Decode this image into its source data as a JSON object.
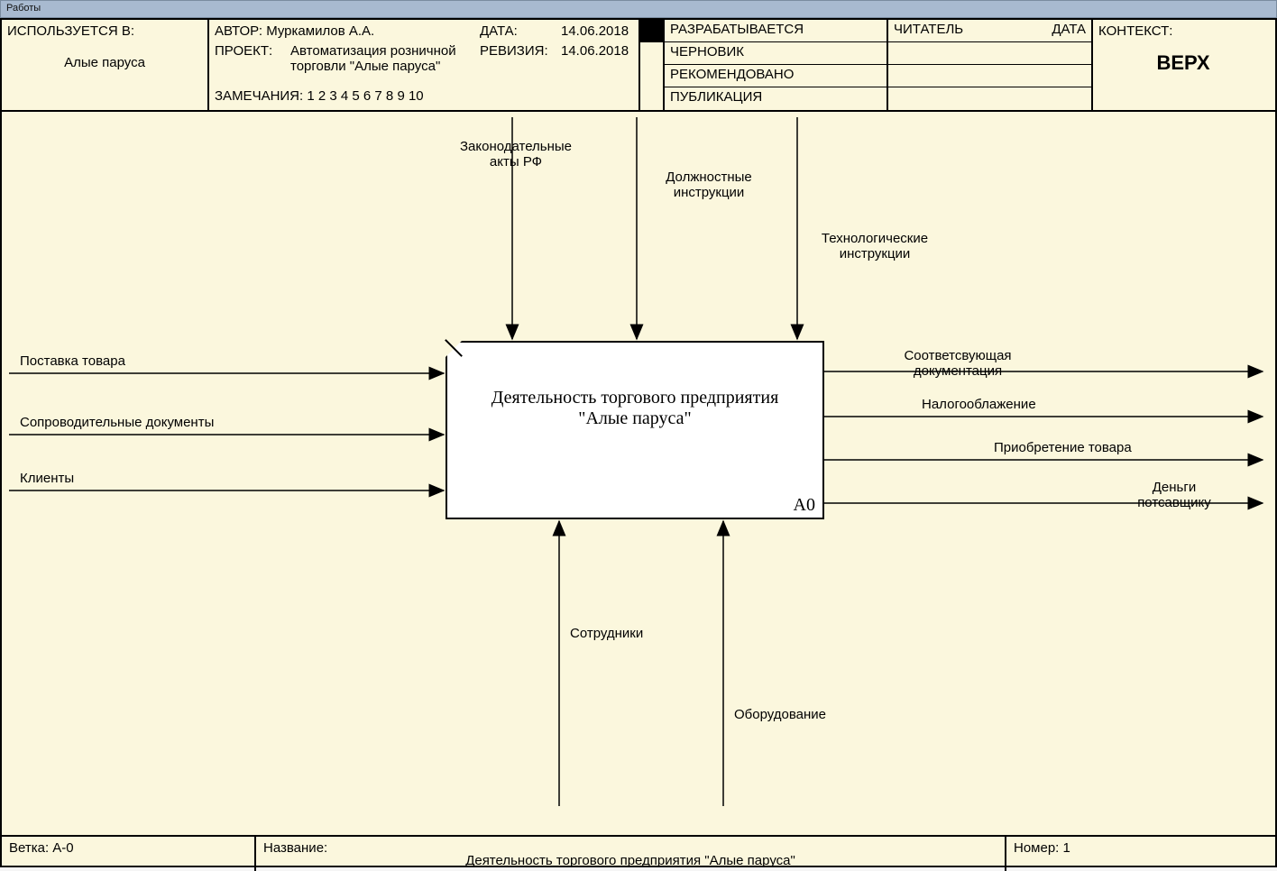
{
  "window_title": "Работы",
  "header": {
    "used_in_label": "ИСПОЛЬЗУЕТСЯ В:",
    "used_in_value": "Алые паруса",
    "author_label": "АВТОР:",
    "author_value": "Муркамилов А.А.",
    "project_label": "ПРОЕКТ:",
    "project_value": "Автоматизация розничной торговли \"Алые паруса\"",
    "notes_label": "ЗАМЕЧАНИЯ:",
    "notes_value": "1 2 3 4 5 6 7 8 9 10",
    "date_label": "ДАТА:",
    "date_value": "14.06.2018",
    "revision_label": "РЕВИЗИЯ:",
    "revision_value": "14.06.2018",
    "status": {
      "developing": "РАЗРАБАТЫВАЕТСЯ",
      "draft": "ЧЕРНОВИК",
      "recommended": "РЕКОМЕНДОВАНО",
      "publication": "ПУБЛИКАЦИЯ"
    },
    "reader_label": "ЧИТАТЕЛЬ",
    "reader_date_label": "ДАТА",
    "context_label": "КОНТЕКСТ:",
    "context_value": "ВЕРХ"
  },
  "box": {
    "title_line1": "Деятельность торгового предприятия",
    "title_line2": "\"Алые паруса\"",
    "code": "A0"
  },
  "arrows": {
    "inputs": {
      "supply": "Поставка товара",
      "docs": "Сопроводительные документы",
      "clients": "Клиенты"
    },
    "controls": {
      "laws_l1": "Законодательные",
      "laws_l2": "акты РФ",
      "job_l1": "Должностные",
      "job_l2": "инструкции",
      "tech_l1": "Технологические",
      "tech_l2": "инструкции"
    },
    "outputs": {
      "corresp_l1": "Соответсвующая",
      "corresp_l2": "документация",
      "tax": "Налогооблажение",
      "purchase": "Приобретение товара",
      "money_l1": "Деньги",
      "money_l2": "потсавщику"
    },
    "mechanisms": {
      "staff": "Сотрудники",
      "equip": "Оборудование"
    }
  },
  "footer": {
    "branch_label": "Ветка:",
    "branch_value": "A-0",
    "name_label": "Название:",
    "name_value": "Деятельность торгового предприятия \"Алые паруса\"",
    "number_label": "Номер:",
    "number_value": "1"
  }
}
